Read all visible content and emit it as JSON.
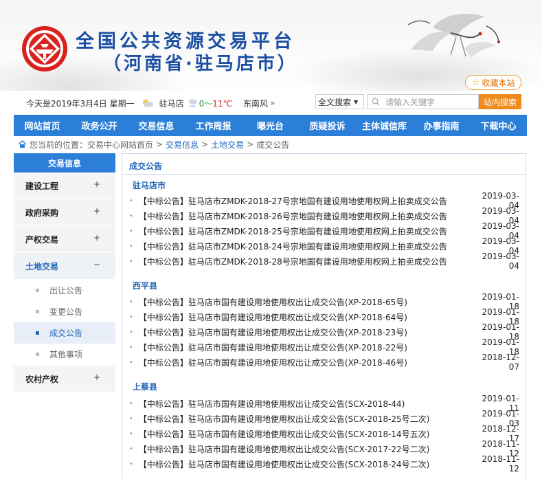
{
  "header": {
    "title_line1": "全国公共资源交易平台",
    "title_line2": "（河南省·驻马店市）",
    "favorite_label": "收藏本站"
  },
  "infobar": {
    "date_text": "今天是2019年3月4日 星期一",
    "city": "驻马店",
    "temp_low": "0",
    "temp_sep": "～",
    "temp_high": "11℃",
    "wind": "东南风",
    "wind_arrow": "»"
  },
  "search": {
    "type_value": "全文搜索",
    "placeholder": "请输入关键字",
    "button_label": "站内搜索"
  },
  "nav": [
    "网站首页",
    "政务公开",
    "交易信息",
    "工作周报",
    "曝光台",
    "质疑投诉",
    "主体诚信库",
    "办事指南",
    "下载中心"
  ],
  "breadcrumb": {
    "prefix": "您当前的位置：",
    "items": [
      "交易中心网站首页",
      "交易信息",
      "土地交易",
      "成交公告"
    ],
    "sep": ">"
  },
  "sidebar": {
    "heading": "交易信息",
    "items": [
      {
        "label": "建设工程",
        "sign": "+"
      },
      {
        "label": "政府采购",
        "sign": "+"
      },
      {
        "label": "产权交易",
        "sign": "+"
      },
      {
        "label": "土地交易",
        "sign": "−"
      }
    ],
    "subitems": [
      "出让公告",
      "变更公告",
      "成交公告",
      "其他事项"
    ],
    "last_item": {
      "label": "农村产权",
      "sign": "+"
    }
  },
  "main": {
    "title": "成交公告",
    "sections": [
      {
        "name": "驻马店市",
        "rows": [
          {
            "title": "【中标公告】驻马店市ZMDK-2018-27号宗地国有建设用地使用权网上拍卖成交公告",
            "date": "2019-03-04"
          },
          {
            "title": "【中标公告】驻马店市ZMDK-2018-26号宗地国有建设用地使用权网上拍卖成交公告",
            "date": "2019-03-04"
          },
          {
            "title": "【中标公告】驻马店市ZMDK-2018-25号宗地国有建设用地使用权网上拍卖成交公告",
            "date": "2019-03-04"
          },
          {
            "title": "【中标公告】驻马店市ZMDK-2018-24号宗地国有建设用地使用权网上拍卖成交公告",
            "date": "2019-03-04"
          },
          {
            "title": "【中标公告】驻马店市ZMDK-2018-28号宗地国有建设用地使用权网上拍卖成交公告",
            "date": "2019-03-04"
          }
        ]
      },
      {
        "name": "西平县",
        "rows": [
          {
            "title": "【中标公告】驻马店市国有建设用地使用权出让成交公告(XP-2018-65号)",
            "date": "2019-01-18"
          },
          {
            "title": "【中标公告】驻马店市国有建设用地使用权出让成交公告(XP-2018-64号)",
            "date": "2019-01-18"
          },
          {
            "title": "【中标公告】驻马店市国有建设用地使用权出让成交公告(XP-2018-23号)",
            "date": "2019-01-18"
          },
          {
            "title": "【中标公告】驻马店市国有建设用地使用权出让成交公告(XP-2018-22号)",
            "date": "2019-01-18"
          },
          {
            "title": "【中标公告】驻马店市国有建设用地使用权出让成交公告(XP-2018-46号)",
            "date": "2018-12-07"
          }
        ]
      },
      {
        "name": "上蔡县",
        "rows": [
          {
            "title": "【中标公告】驻马店市国有建设用地使用权出让成交公告(SCX-2018-44)",
            "date": "2019-01-11"
          },
          {
            "title": "【中标公告】驻马店市国有建设用地使用权出让成交公告(SCX-2018-25号二次)",
            "date": "2019-01-03"
          },
          {
            "title": "【中标公告】驻马店市国有建设用地使用权出让成交公告(SCX-2018-14号五次)",
            "date": "2018-12-17"
          },
          {
            "title": "【中标公告】驻马店市国有建设用地使用权出让成交公告(SCX-2017-22号二次)",
            "date": "2018-11-12"
          },
          {
            "title": "【中标公告】驻马店市国有建设用地使用权出让成交公告(SCX-2018-24号二次)",
            "date": "2018-11-12"
          }
        ]
      }
    ]
  }
}
